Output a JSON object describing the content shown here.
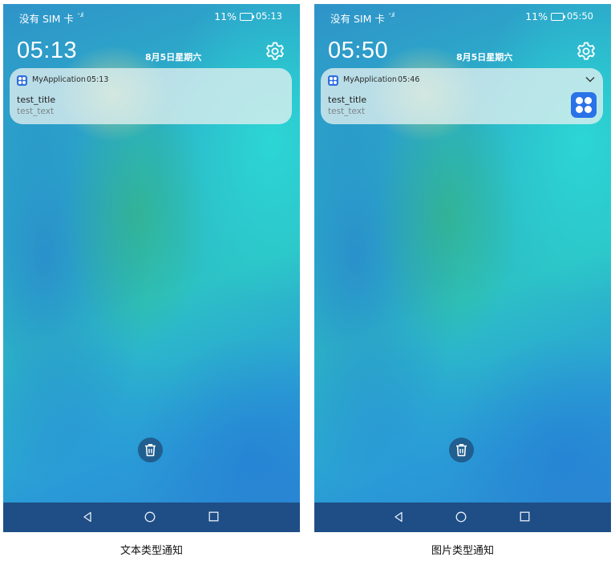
{
  "screens": [
    {
      "status_bar": {
        "carrier": "没有 SIM 卡",
        "battery": "11%",
        "time": "05:13"
      },
      "clock": "05:13",
      "date": "8月5日星期六",
      "notification": {
        "app_name": "MyApplication",
        "time": "05:13",
        "title": "test_title",
        "text": "test_text",
        "has_expand": false,
        "has_image": false
      },
      "caption": "文本类型通知"
    },
    {
      "status_bar": {
        "carrier": "没有 SIM 卡",
        "battery": "11%",
        "time": "05:50"
      },
      "clock": "05:50",
      "date": "8月5日星期六",
      "notification": {
        "app_name": "MyApplication",
        "time": "05:46",
        "title": "test_title",
        "text": "test_text",
        "has_expand": true,
        "has_image": true
      },
      "caption": "图片类型通知"
    }
  ],
  "icons": {
    "settings": "gear-icon",
    "app": "app-icon",
    "delete": "trash-icon",
    "expand": "chevron-down-icon",
    "notification_image": "app-image-icon",
    "nav_back": "triangle-back-icon",
    "nav_home": "circle-home-icon",
    "nav_recents": "square-recents-icon"
  },
  "colors": {
    "accent": "#2f6ee0",
    "navbar": "#1f4e86",
    "card": "#e1f0f0"
  }
}
